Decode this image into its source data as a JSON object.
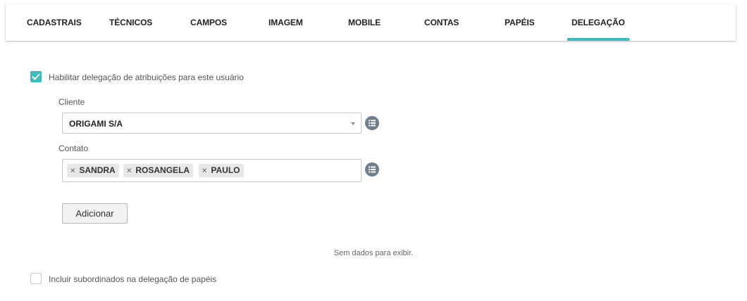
{
  "tabs": [
    {
      "label": "CADASTRAIS",
      "active": false
    },
    {
      "label": "TÉCNICOS",
      "active": false
    },
    {
      "label": "CAMPOS",
      "active": false
    },
    {
      "label": "IMAGEM",
      "active": false
    },
    {
      "label": "MOBILE",
      "active": false
    },
    {
      "label": "CONTAS",
      "active": false
    },
    {
      "label": "PAPÉIS",
      "active": false
    },
    {
      "label": "DELEGAÇÃO",
      "active": true
    }
  ],
  "delegation": {
    "enable_label": "Habilitar delegação de atribuições para este usuário",
    "enable_checked": true,
    "client_label": "Cliente",
    "client_value": "ORIGAMI S/A",
    "contact_label": "Contato",
    "contacts": [
      "SANDRA",
      "ROSANGELA",
      "PAULO"
    ],
    "add_label": "Adicionar",
    "empty_message": "Sem dados para exibir.",
    "subordinates_label": "Incluir subordinados na delegação de papéis",
    "subordinates_checked": false
  },
  "colors": {
    "accent": "#3bbcbf",
    "list_button": "#6e7f8f"
  },
  "icons": {
    "check": "check-icon",
    "list": "list-icon",
    "remove": "close-icon",
    "caret": "chevron-down-icon"
  }
}
